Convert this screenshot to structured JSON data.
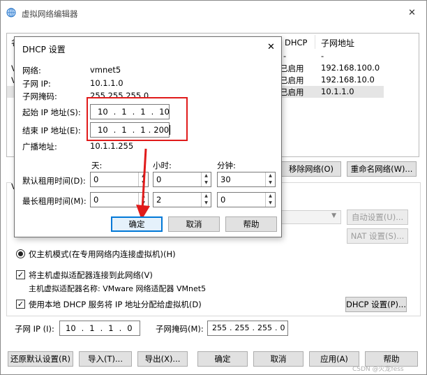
{
  "main_window": {
    "title": "虚拟网络编辑器",
    "close_glyph": "✕",
    "table": {
      "col_first_partial": "名",
      "col_dhcp": "DHCP",
      "col_subnet": "子网地址",
      "row_first_partial": [
        "V",
        "V",
        "V"
      ],
      "rows": [
        {
          "dhcp": "-",
          "subnet": "-"
        },
        {
          "dhcp": "已启用",
          "subnet": "192.168.100.0"
        },
        {
          "dhcp": "已启用",
          "subnet": "192.168.10.0"
        },
        {
          "dhcp": "已启用",
          "subnet": "10.1.1.0"
        }
      ]
    },
    "buttons": {
      "remove_network": "移除网络(O)",
      "rename_network": "重命名网络(W)...",
      "auto_settings": "自动设置(U)...",
      "nat_settings": "NAT 设置(S)...",
      "dhcp_settings": "DHCP 设置(P)..."
    },
    "host_only_mode": "仅主机模式(在专用网络内连接虚拟机)(H)",
    "connect_host_adapter": "将主机虚拟适配器连接到此网络(V)",
    "host_adapter_name": "主机虚拟适配器名称: VMware 网络适配器 VMnet5",
    "use_local_dhcp": "使用本地 DHCP 服务将 IP 地址分配给虚拟机(D)",
    "subnet_ip_label": "子网 IP (I):",
    "subnet_ip_octets": [
      "10",
      "1",
      "1",
      "0"
    ],
    "subnet_mask_label": "子网掩码(M):",
    "subnet_mask_octets": [
      "255",
      "255",
      "255",
      "0"
    ],
    "footer": {
      "restore_defaults": "还原默认设置(R)",
      "import": "导入(T)...",
      "export": "导出(X)...",
      "ok": "确定",
      "cancel": "取消",
      "apply": "应用(A)",
      "help": "帮助"
    },
    "watermark": "CSDN @火龙fess"
  },
  "dhcp_dialog": {
    "title": "DHCP 设置",
    "close_glyph": "✕",
    "network_label": "网络:",
    "network_value": "vmnet5",
    "subnet_ip_label": "子网 IP:",
    "subnet_ip_value": "10.1.1.0",
    "subnet_mask_label": "子网掩码:",
    "subnet_mask_value": "255.255.255.0",
    "start_ip_label": "起始 IP 地址(S):",
    "start_ip_octets": [
      "10",
      "1",
      "1",
      "10"
    ],
    "end_ip_label": "结束 IP 地址(E):",
    "end_ip_octets": [
      "10",
      "1",
      "1",
      "200"
    ],
    "broadcast_label": "广播地址:",
    "broadcast_value": "10.1.1.255",
    "days_label": "天:",
    "hours_label": "小时:",
    "minutes_label": "分钟:",
    "default_lease_label": "默认租用时间(D):",
    "default_lease": {
      "days": "0",
      "hours": "0",
      "minutes": "30"
    },
    "max_lease_label": "最长租用时间(M):",
    "max_lease": {
      "days": "0",
      "hours": "2",
      "minutes": "0"
    },
    "ok": "确定",
    "cancel": "取消",
    "help": "帮助"
  },
  "colors": {
    "highlight_box": "#e01b1b",
    "focus_border": "#0078d7",
    "selected_row": "#e5e5e5"
  }
}
